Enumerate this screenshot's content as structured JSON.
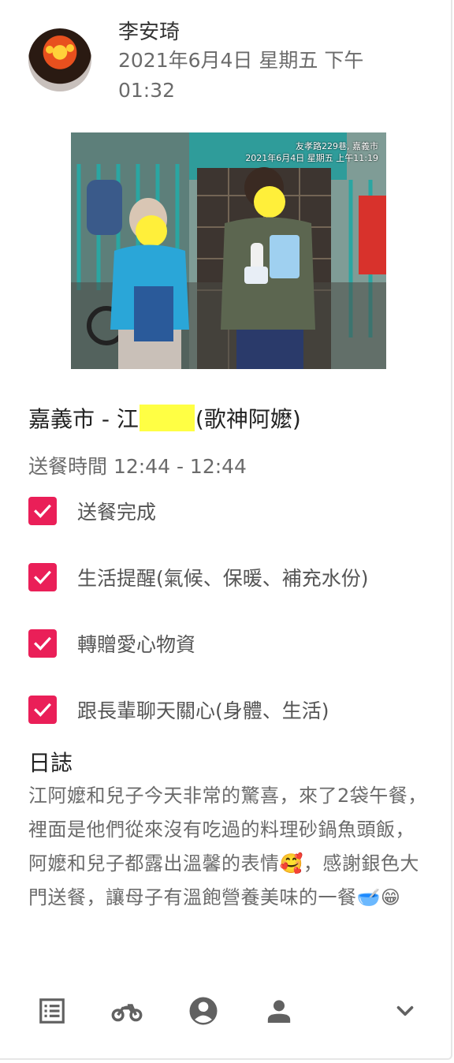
{
  "post": {
    "author": "李安琦",
    "timestamp": "2021年6月4日 星期五 下午 01:32"
  },
  "photo": {
    "watermark_line1": "友孝路229巷, 嘉義市",
    "watermark_line2": "2021年6月4日 星期五 上午11:19"
  },
  "delivery": {
    "title_prefix": "嘉義市 - 江",
    "title_suffix": "(歌神阿嬤)",
    "time_label": "送餐時間 12:44 - 12:44"
  },
  "checklist": [
    {
      "label": "送餐完成",
      "checked": true
    },
    {
      "label": "生活提醒(氣候、保暖、補充水份)",
      "checked": true
    },
    {
      "label": "轉贈愛心物資",
      "checked": true
    },
    {
      "label": "跟長輩聊天關心(身體、生活)",
      "checked": true
    }
  ],
  "log": {
    "title": "日誌",
    "body": "江阿嬤和兒子今天非常的驚喜，來了2袋午餐，裡面是他們從來沒有吃過的料理砂鍋魚頭飯，阿嬤和兒子都露出溫馨的表情🥰，感謝銀色大門送餐，讓母子有溫飽營養美味的一餐🥣😁"
  },
  "bottom_bar": {
    "icons": [
      "list-icon",
      "motorcycle-icon",
      "account-circle-icon",
      "person-icon",
      "chevron-down-icon"
    ]
  },
  "colors": {
    "checkbox": "#ea1f58",
    "icon": "#616161"
  }
}
